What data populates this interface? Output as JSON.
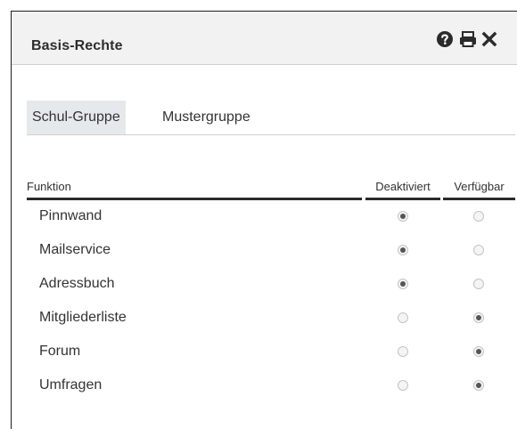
{
  "dialog": {
    "title": "Basis-Rechte",
    "icons": [
      "help-icon",
      "print-icon",
      "close-icon"
    ]
  },
  "group": {
    "label": "Schul-Gruppe",
    "value": "Mustergruppe"
  },
  "table": {
    "headers": {
      "function": "Funktion",
      "deactivated": "Deaktiviert",
      "available": "Verfügbar"
    },
    "rows": [
      {
        "label": "Pinnwand",
        "selected": "deactivated"
      },
      {
        "label": "Mailservice",
        "selected": "deactivated"
      },
      {
        "label": "Adressbuch",
        "selected": "deactivated"
      },
      {
        "label": "Mitgliederliste",
        "selected": "available"
      },
      {
        "label": "Forum",
        "selected": "available"
      },
      {
        "label": "Umfragen",
        "selected": "available"
      }
    ]
  }
}
